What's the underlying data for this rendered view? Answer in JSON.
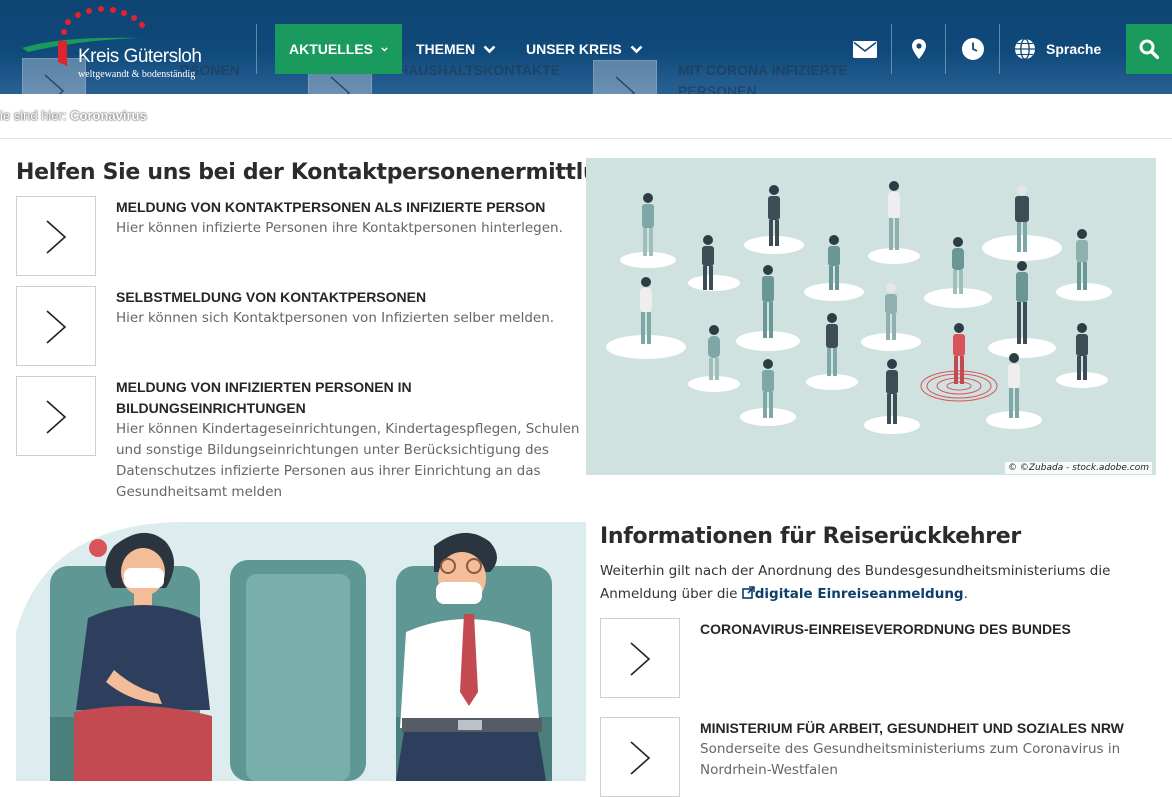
{
  "header": {
    "logo_title": "Kreis Gütersloh",
    "logo_subtitle": "weltgewandt & bodenständig",
    "nav": [
      {
        "label": "AKTUELLES",
        "active": true
      },
      {
        "label": "THEMEN",
        "active": false
      },
      {
        "label": "UNSER KREIS",
        "active": false
      }
    ],
    "icons": [
      "envelope-icon",
      "map-pin-icon",
      "clock-icon",
      "globe-icon"
    ],
    "language_label": "Sprache",
    "search_icon": "search-icon",
    "ghost_items": [
      "RSONEN",
      "HAUSHALTSKONTAKTE",
      "MIT CORONA INFIZIERTE PERSONEN"
    ],
    "colors": {
      "header_bg": "#0f4a7b",
      "accent": "#1a9a5c"
    }
  },
  "breadcrumb": {
    "prefix": "ie sind hier:",
    "current": "Coronavirus"
  },
  "contact_section": {
    "title": "Helfen Sie uns bei der Kontaktpersonenermittlung",
    "items": [
      {
        "title": "MELDUNG VON KONTAKTPERSONEN ALS INFIZIERTE PERSON",
        "desc": "Hier können infizierte Personen ihre Kontaktpersonen hinterlegen."
      },
      {
        "title": "SELBSTMELDUNG VON KONTAKTPERSONEN",
        "desc": "Hier können sich Kontaktpersonen von Infizierten selber melden."
      },
      {
        "title_line1": "MELDUNG VON INFIZIERTEN PERSONEN IN",
        "title_line2": "BILDUNGSEINRICHTUNGEN",
        "desc_lines": [
          "Hier können Kindertageseinrichtungen, Kindertagespflegen, Schulen",
          "und sonstige Bildungseinrichtungen unter Berücksichtigung des",
          "Datenschutzes infizierte Personen aus ihrer Einrichtung an das",
          "Gesundheitsamt melden"
        ]
      }
    ],
    "image_credit": "© ©Zubada - stock.adobe.com"
  },
  "travel_section": {
    "title": "Informationen für Reiserückkehrer",
    "para_line1": "Weiterhin gilt nach der Anordnung des Bundesgesundheitsministeriums die",
    "para_line2_prefix": "Anmeldung über die",
    "link_label": "digitale Einreiseanmeldung",
    "para_line2_suffix": ".",
    "items": [
      {
        "title": "CORONAVIRUS-EINREISEVERORDNUNG DES BUNDES"
      },
      {
        "title": "MINISTERIUM FÜR ARBEIT, GESUNDHEIT UND SOZIALES NRW",
        "desc_lines": [
          "Sonderseite des Gesundheitsministeriums zum Coronavirus in",
          "Nordrhein-Westfalen"
        ]
      }
    ]
  }
}
